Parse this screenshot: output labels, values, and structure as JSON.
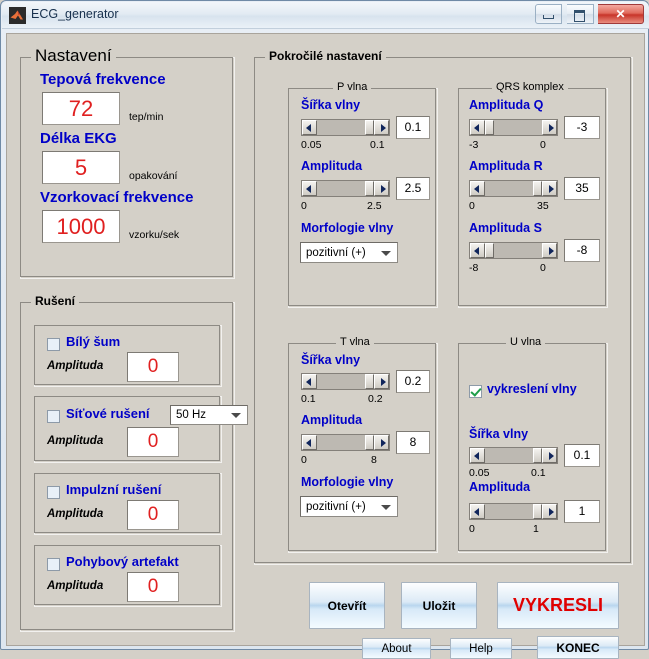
{
  "window": {
    "title": "ECG_generator",
    "icon": "matlab-icon",
    "controls": {
      "minimize": "minimize-icon",
      "maximize": "maximize-icon",
      "close": "✕"
    }
  },
  "settings_panel": {
    "title": "Nastavení",
    "fields": [
      {
        "label": "Tepová frekvence",
        "value": "72",
        "unit": "tep/min"
      },
      {
        "label": "Délka EKG",
        "value": "5",
        "unit": "opakování"
      },
      {
        "label": "Vzorkovací frekvence",
        "value": "1000",
        "unit": "vzorku/sek"
      }
    ]
  },
  "noise_panel": {
    "title": "Rušení",
    "amplitude_label": "Amplituda",
    "items": [
      {
        "label": "Bílý šum",
        "checked": false,
        "amplitude": "0",
        "has_dropdown": false
      },
      {
        "label": "Síťové rušení",
        "checked": false,
        "amplitude": "0",
        "has_dropdown": true,
        "dropdown_value": "50 Hz"
      },
      {
        "label": "Impulzní rušení",
        "checked": false,
        "amplitude": "0",
        "has_dropdown": false
      },
      {
        "label": "Pohybový artefakt",
        "checked": false,
        "amplitude": "0",
        "has_dropdown": false
      }
    ]
  },
  "advanced_panel": {
    "title": "Pokročilé nastavení",
    "groups": {
      "p_wave": {
        "title": "P vlna",
        "width": {
          "label": "Šířka vlny",
          "value": "0.1",
          "min": "0.05",
          "max": "0.1",
          "thumb_pct": 100
        },
        "amplitude": {
          "label": "Amplituda",
          "value": "2.5",
          "min": "0",
          "max": "2.5",
          "thumb_pct": 100
        },
        "morphology": {
          "label": "Morfologie vlny",
          "value": "pozitivní (+)"
        }
      },
      "qrs": {
        "title": "QRS komplex",
        "q": {
          "label": "Amplituda Q",
          "value": "-3",
          "min": "-3",
          "max": "0",
          "thumb_pct": 0
        },
        "r": {
          "label": "Amplituda R",
          "value": "35",
          "min": "0",
          "max": "35",
          "thumb_pct": 100
        },
        "s": {
          "label": "Amplituda S",
          "value": "-8",
          "min": "-8",
          "max": "0",
          "thumb_pct": 0
        }
      },
      "t_wave": {
        "title": "T vlna",
        "width": {
          "label": "Šířka vlny",
          "value": "0.2",
          "min": "0.1",
          "max": "0.2",
          "thumb_pct": 100
        },
        "amplitude": {
          "label": "Amplituda",
          "value": "8",
          "min": "0",
          "max": "8",
          "thumb_pct": 100
        },
        "morphology": {
          "label": "Morfologie vlny",
          "value": "pozitivní (+)"
        }
      },
      "u_wave": {
        "title": "U vlna",
        "draw_checkbox": {
          "label": "vykreslení vlny",
          "checked": true
        },
        "width": {
          "label": "Šířka vlny",
          "value": "0.1",
          "min": "0.05",
          "max": "0.1",
          "thumb_pct": 100
        },
        "amplitude": {
          "label": "Amplituda",
          "value": "1",
          "min": "0",
          "max": "1",
          "thumb_pct": 100
        }
      }
    }
  },
  "actions": {
    "open": "Otevřít",
    "save": "Uložit",
    "plot": "VYKRESLI",
    "about": "About",
    "help": "Help",
    "quit": "KONEC"
  },
  "colors": {
    "label_blue": "#0000c8",
    "value_red": "#e02020",
    "plot_red": "#e00000",
    "check_green": "#1e9e4a",
    "window_bg": "#d4d0c8"
  }
}
